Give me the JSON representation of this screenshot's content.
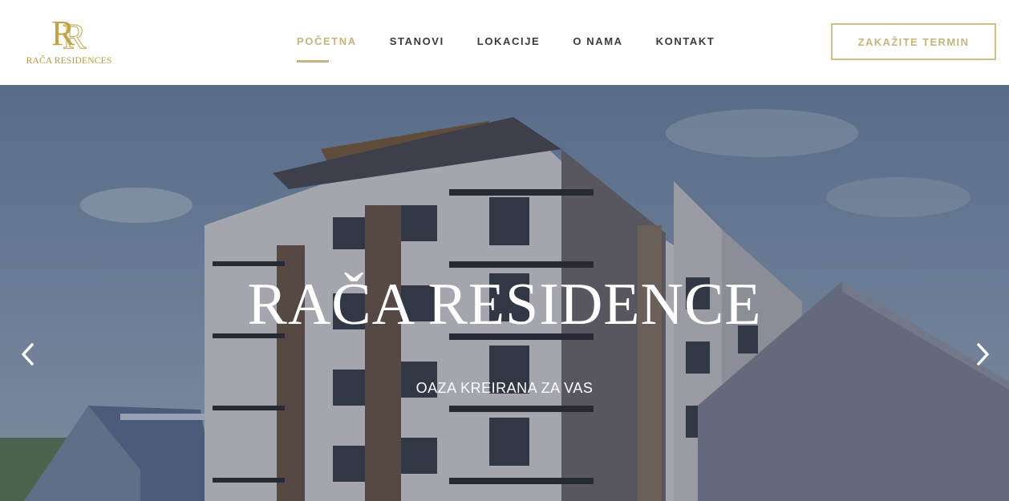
{
  "brand": {
    "name": "RAČA RESIDENCES",
    "gold": "#b99a3c"
  },
  "nav": {
    "items": [
      {
        "label": "POČETNA",
        "active": true
      },
      {
        "label": "STANOVI",
        "active": false
      },
      {
        "label": "LOKACIJE",
        "active": false
      },
      {
        "label": "O NAMA",
        "active": false
      },
      {
        "label": "KONTAKT",
        "active": false
      }
    ],
    "accent": "#c7b47c"
  },
  "cta": {
    "label": "ZAKAŽITE TERMIN"
  },
  "hero": {
    "title": "RAČA RESIDENCE",
    "subtitle": "OAZA KREIRANA ZA VAS",
    "prev_icon": "chevron-left-icon",
    "next_icon": "chevron-right-icon"
  }
}
